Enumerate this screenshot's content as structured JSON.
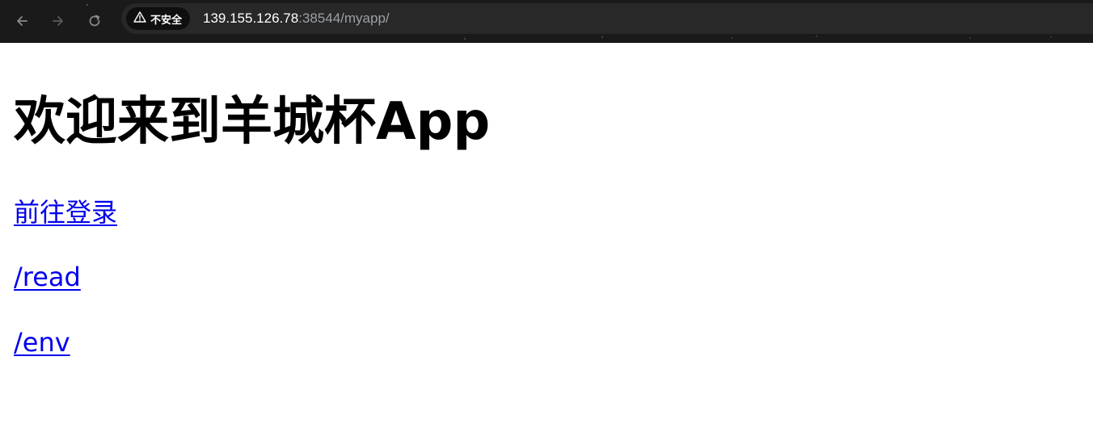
{
  "browser": {
    "security_label": "不安全",
    "url_host": "139.155.126.78",
    "url_rest": ":38544/myapp/",
    "icons": {
      "back": "arrow-left-icon",
      "forward": "arrow-right-icon",
      "reload": "reload-icon",
      "security": "warning-triangle-icon"
    }
  },
  "page": {
    "heading": "欢迎来到羊城杯App",
    "links": [
      {
        "label": "前往登录"
      },
      {
        "label": "/read"
      },
      {
        "label": "/env"
      }
    ]
  },
  "colors": {
    "toolbar_bg": "#1a1a1a",
    "omnibox_bg": "#282828",
    "link": "#0000ee",
    "url_dim": "#9aa0a6"
  }
}
